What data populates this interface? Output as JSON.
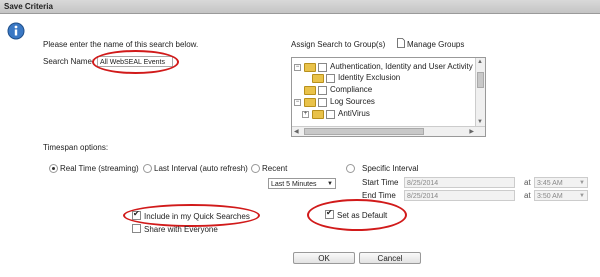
{
  "window": {
    "title": "Save Criteria"
  },
  "instructions": "Please enter the name of this search below.",
  "search_name": {
    "label": "Search Name:",
    "value": "All WebSEAL Events"
  },
  "groups": {
    "label": "Assign Search to Group(s)",
    "manage_label": "Manage Groups",
    "tree": [
      {
        "label": "Authentication, Identity and User Activity",
        "level": 0,
        "expander": "-"
      },
      {
        "label": "Identity Exclusion",
        "level": 1,
        "expander": ""
      },
      {
        "label": "Compliance",
        "level": 0,
        "expander": ""
      },
      {
        "label": "Log Sources",
        "level": 0,
        "expander": "-"
      },
      {
        "label": "AntiVirus",
        "level": 1,
        "expander": "+"
      }
    ]
  },
  "timespan": {
    "label": "Timespan options:",
    "realtime_label": "Real Time (streaming)",
    "last_interval_label": "Last Interval (auto refresh)",
    "recent_label": "Recent",
    "specific_label": "Specific Interval",
    "recent_value": "Last 5 Minutes",
    "start_label": "Start Time",
    "start_date": "8/25/2014",
    "at1": "at",
    "start_time": "3:45 AM",
    "end_label": "End Time",
    "end_date": "8/25/2014",
    "at2": "at",
    "end_time": "3:50 AM"
  },
  "options": {
    "quick_searches_label": "Include in my Quick Searches",
    "share_label": "Share with Everyone",
    "default_label": "Set as Default"
  },
  "buttons": {
    "ok": "OK",
    "cancel": "Cancel"
  },
  "colors": {
    "annotation": "#d11a1a",
    "titlebar": "#c4c4c4"
  }
}
